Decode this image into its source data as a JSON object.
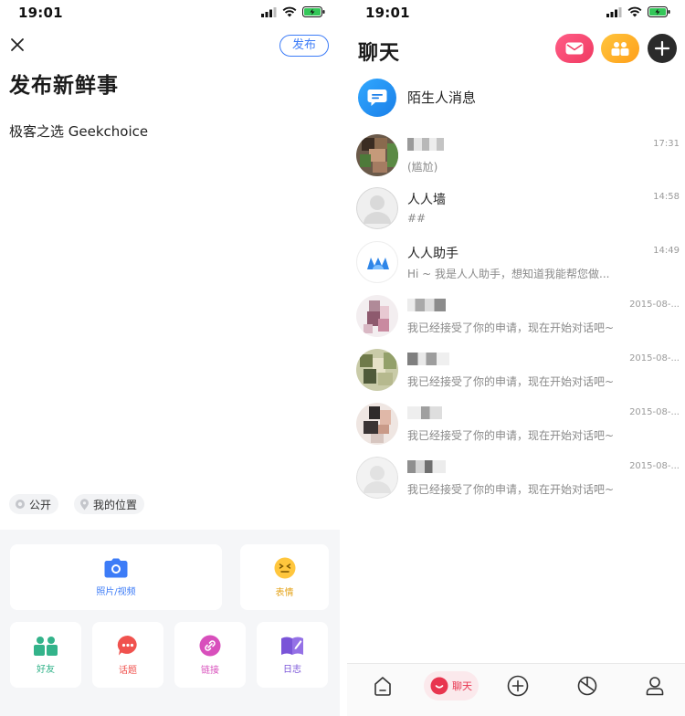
{
  "status_bar": {
    "time_left": "19:01",
    "time_right": "19:01"
  },
  "composer": {
    "publish_label": "发布",
    "title": "发布新鲜事",
    "content_text": "极客之选 Geekchoice",
    "privacy_label": "公开",
    "location_label": "我的位置",
    "tools": {
      "photo_video": "照片/视频",
      "emoji": "表情",
      "friends": "好友",
      "topic": "话题",
      "link": "链接",
      "diary": "日志"
    }
  },
  "chat": {
    "title": "聊天",
    "stranger_messages": "陌生人消息",
    "conversations": [
      {
        "name": "",
        "message": "(尴尬)",
        "time": "17:31"
      },
      {
        "name": "人人墙",
        "message": "##",
        "time": "14:58"
      },
      {
        "name": "人人助手",
        "message": "Hi ~ 我是人人助手，想知道我能帮您做...",
        "time": "14:49"
      },
      {
        "name": "",
        "message": "我已经接受了你的申请，现在开始对话吧~",
        "time": "2015-08-..."
      },
      {
        "name": "",
        "message": "我已经接受了你的申请，现在开始对话吧~",
        "time": "2015-08-..."
      },
      {
        "name": "",
        "message": "我已经接受了你的申请，现在开始对话吧~",
        "time": "2015-08-..."
      },
      {
        "name": "",
        "message": "我已经接受了你的申请，现在开始对话吧~",
        "time": "2015-08-..."
      }
    ],
    "tabbar": {
      "chat_label": "聊天"
    }
  },
  "colors": {
    "accent_blue": "#3d7cf7",
    "chat_red": "#e8354f",
    "mail_pill": "#f03a62",
    "group_pill": "#ff9f1a",
    "stranger_icon": "#1a7fe8"
  },
  "icons": [
    "close-icon",
    "camera-icon",
    "emoji-icon",
    "friends-icon",
    "topic-icon",
    "link-icon",
    "diary-icon",
    "globe-icon",
    "location-pin-icon",
    "mail-icon",
    "group-icon",
    "plus-icon",
    "chat-bubble-icon",
    "home-icon",
    "discover-icon",
    "profile-icon"
  ]
}
